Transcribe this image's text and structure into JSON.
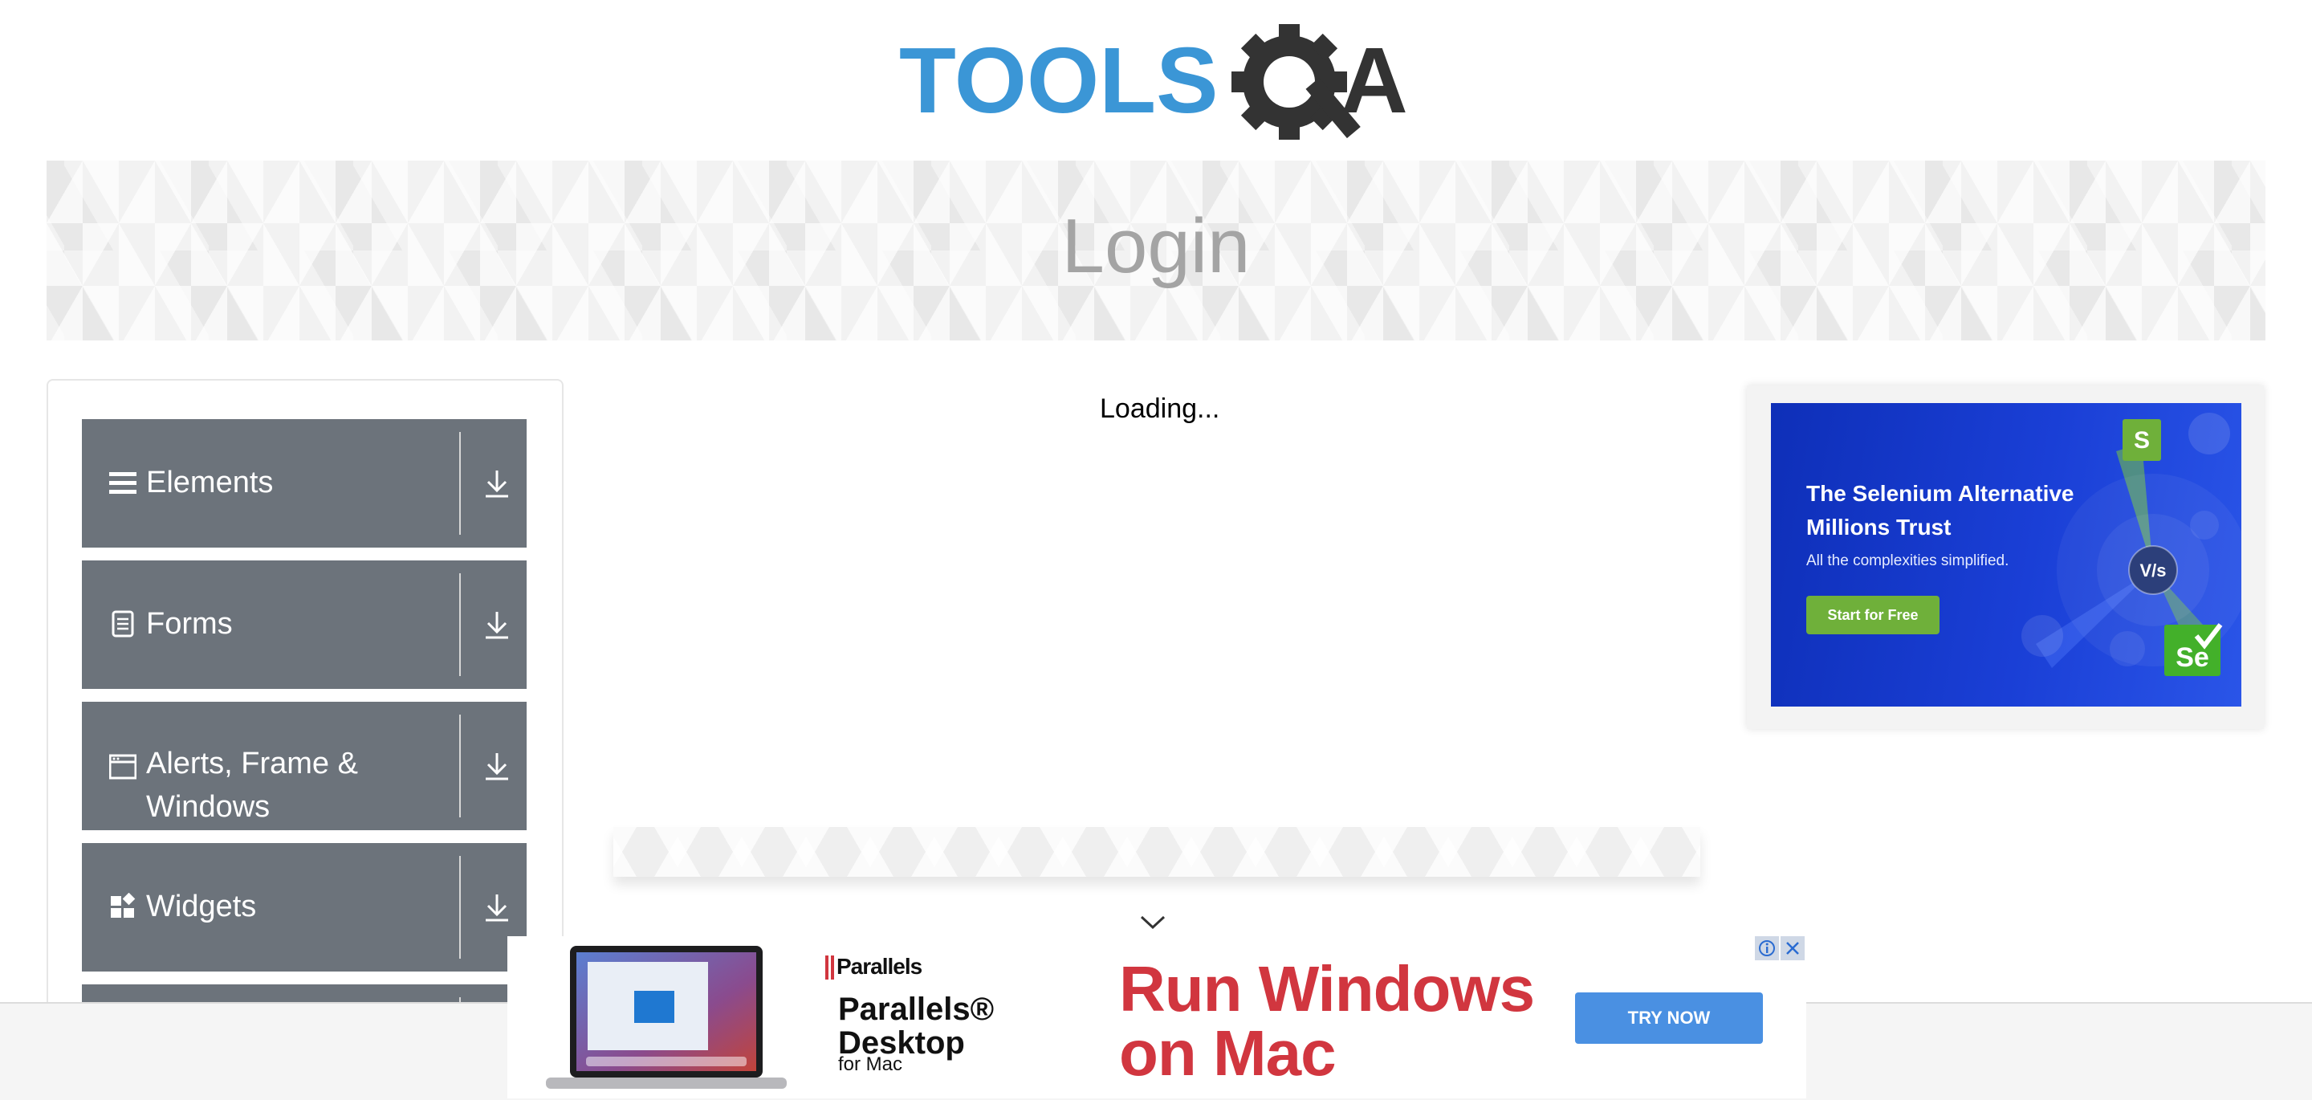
{
  "header": {
    "logo_text_blue": "TOOLS",
    "logo_text_dark": "A",
    "brand_colors": {
      "blue": "#3b96d6",
      "dark": "#333333"
    }
  },
  "banner": {
    "title": "Login"
  },
  "sidebar": {
    "groups": [
      {
        "label": "Elements",
        "icon": "hamburger-icon"
      },
      {
        "label": "Forms",
        "icon": "document-icon"
      },
      {
        "label": "Alerts, Frame & Windows",
        "icon": "window-icon"
      },
      {
        "label": "Widgets",
        "icon": "widgets-icon"
      }
    ],
    "group_color": "#6c737b"
  },
  "main": {
    "loading_text": "Loading..."
  },
  "right_ad": {
    "headline": "The Selenium Alternative Millions Trust",
    "subtext": "All the complexities simplified.",
    "cta_label": "Start for Free",
    "badge_vs": "V/s",
    "badge_s": "S",
    "badge_se": "Se",
    "background": "#1a3fd6",
    "cta_color": "#6fb03a"
  },
  "bottom_ad": {
    "brand": "Parallels",
    "product": "Parallels® Desktop",
    "product_sub": "for Mac",
    "headline": "Run Windows on Mac",
    "cta_label": "TRY NOW",
    "headline_color": "#d1363f",
    "cta_color": "#4a90e2"
  }
}
